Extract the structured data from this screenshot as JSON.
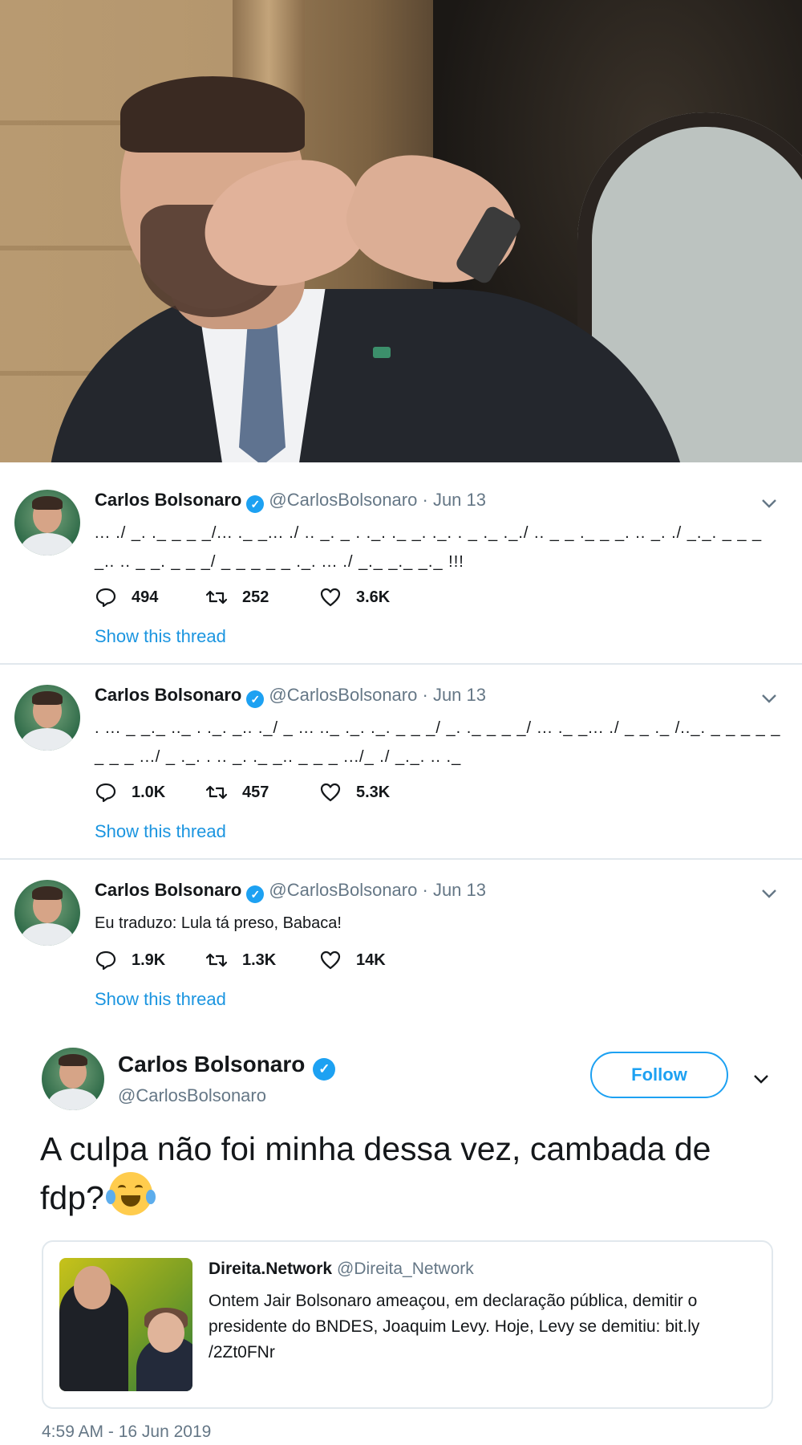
{
  "tweets": [
    {
      "name": "Carlos Bolsonaro",
      "handle": "@CarlosBolsonaro",
      "sep": "·",
      "date": "Jun 13",
      "text": "... ./ _. ._ _ _ _/... ._ _... ./ .. _. _ . ._. ._ _. ._. . _ ._ ._./ .. _ _ ._ _ _. .. _. ./ _._. _ _ _ _.. .. _ _. _ _ _/ _ _ _ _ _ ._. ... ./ _._ _._ _._ !!!",
      "replies": "494",
      "retweets": "252",
      "likes": "3.6K",
      "thread_label": "Show this thread"
    },
    {
      "name": "Carlos Bolsonaro",
      "handle": "@CarlosBolsonaro",
      "sep": "·",
      "date": "Jun 13",
      "text": ". ... _ _._ .._ . ._. _.. ._/ _ ... .._ ._. ._. _ _ _/ _. ._ _ _ _/ ... ._ _... ./ _ _ ._ /.._. _ _ _ _ _ _ _ _ .../ _ ._. . .. _. ._ _.. _ _ _ .../_ ./ _._. .. ._",
      "replies": "1.0K",
      "retweets": "457",
      "likes": "5.3K",
      "thread_label": "Show this thread"
    },
    {
      "name": "Carlos Bolsonaro",
      "handle": "@CarlosBolsonaro",
      "sep": "·",
      "date": "Jun 13",
      "text": "Eu traduzo: Lula tá preso, Babaca!",
      "replies": "1.9K",
      "retweets": "1.3K",
      "likes": "14K",
      "thread_label": "Show this thread"
    }
  ],
  "main": {
    "name": "Carlos Bolsonaro",
    "handle": "@CarlosBolsonaro",
    "follow_label": "Follow",
    "text": "A culpa não foi minha dessa vez, cambada de fdp?",
    "quoted": {
      "name": "Direita.Network",
      "handle": "@Direita_Network",
      "text": "Ontem Jair Bolsonaro ameaçou, em declaração pública, demitir o presidente do BNDES, Joaquim Levy. Hoje, Levy se demitiu: bit.ly /2Zt0FNr"
    },
    "timestamp": "4:59 AM - 16 Jun 2019"
  },
  "icons": {
    "verified": "verified-badge-icon",
    "reply": "reply-icon",
    "retweet": "retweet-icon",
    "like": "heart-icon",
    "caret": "chevron-down-icon",
    "emoji": "face-with-tears-of-joy-emoji"
  },
  "colors": {
    "link": "#1b95e0",
    "accent": "#1da1f2",
    "muted": "#657786",
    "text": "#14171a",
    "border": "#e1e8ed"
  }
}
